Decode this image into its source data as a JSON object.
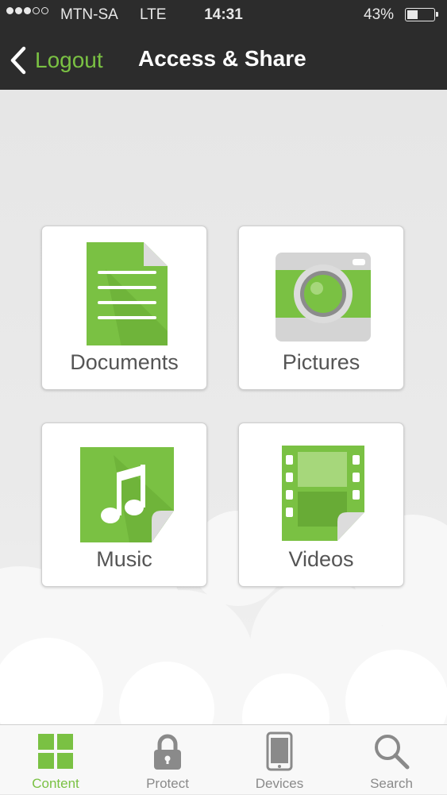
{
  "status": {
    "carrier": "MTN-SA",
    "network": "LTE",
    "time": "14:31",
    "battery": "43%",
    "battery_level": 0.43,
    "signal_bars": 3,
    "signal_total": 5
  },
  "nav": {
    "back_label": "Logout",
    "title": "Access & Share"
  },
  "tiles": [
    {
      "label": "Documents",
      "icon": "document-icon"
    },
    {
      "label": "Pictures",
      "icon": "camera-icon"
    },
    {
      "label": "Music",
      "icon": "music-note-icon"
    },
    {
      "label": "Videos",
      "icon": "film-icon"
    }
  ],
  "tabs": [
    {
      "label": "Content",
      "icon": "grid-icon",
      "active": true
    },
    {
      "label": "Protect",
      "icon": "lock-icon",
      "active": false
    },
    {
      "label": "Devices",
      "icon": "phone-icon",
      "active": false
    },
    {
      "label": "Search",
      "icon": "search-icon",
      "active": false
    }
  ],
  "colors": {
    "accent": "#7ac143",
    "nav_background": "#2c2c2c",
    "inactive_tab": "#8a8a8a"
  }
}
